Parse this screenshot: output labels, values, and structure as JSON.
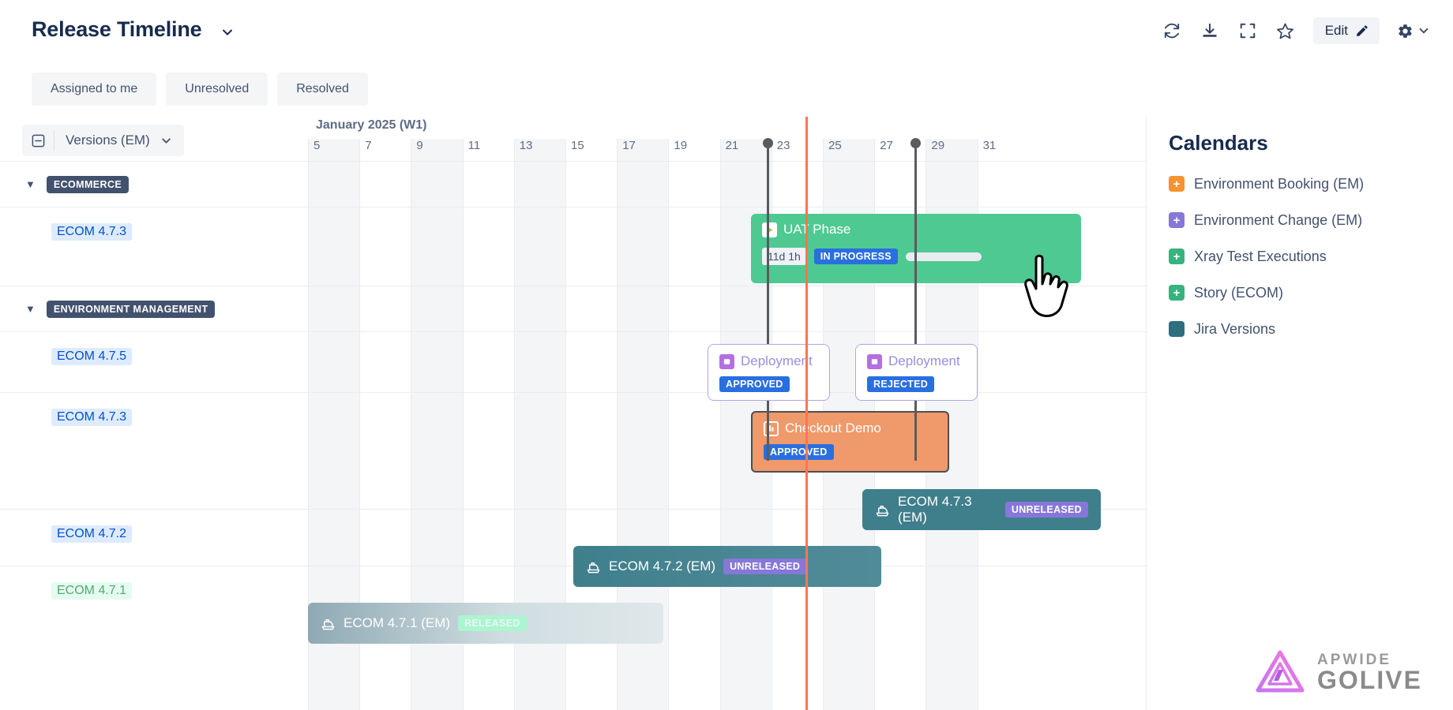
{
  "header": {
    "title": "Release Timeline",
    "title_chevron_icon": "chevron-down-icon",
    "toolbar": {
      "refresh_icon": "refresh-icon",
      "download_icon": "download-icon",
      "fullscreen_icon": "fullscreen-icon",
      "favorite_icon": "star-icon",
      "edit_label": "Edit",
      "edit_icon": "pencil-icon",
      "settings_icon": "gear-icon",
      "settings_chevron_icon": "chevron-down-icon"
    }
  },
  "filters": [
    {
      "label": "Assigned to me"
    },
    {
      "label": "Unresolved"
    },
    {
      "label": "Resolved"
    }
  ],
  "left_panel": {
    "collapse_icon": "collapse-minus-icon",
    "grouping_label": "Versions (EM)",
    "grouping_chevron_icon": "chevron-down-icon",
    "rows": [
      {
        "type": "group",
        "label": "ECOMMERCE",
        "caret_icon": "caret-down-icon"
      },
      {
        "type": "version",
        "label": "ECOM 4.7.3",
        "style": "blue"
      },
      {
        "type": "group",
        "label": "ENVIRONMENT MANAGEMENT",
        "caret_icon": "caret-down-icon"
      },
      {
        "type": "version",
        "label": "ECOM 4.7.5",
        "style": "blue"
      },
      {
        "type": "version",
        "label": "ECOM 4.7.3",
        "style": "blue"
      },
      {
        "type": "version",
        "label": "ECOM 4.7.2",
        "style": "blue"
      },
      {
        "type": "version",
        "label": "ECOM 4.7.1",
        "style": "green"
      }
    ]
  },
  "timeline": {
    "month_label": "January 2025 (W1)",
    "day_ticks": [
      "5",
      "7",
      "9",
      "11",
      "13",
      "15",
      "17",
      "19",
      "21",
      "23",
      "25",
      "27",
      "29",
      "31"
    ],
    "today_marker_color": "#ff7452",
    "events": [
      {
        "id": "uat-phase",
        "title": "UAT Phase",
        "icon": "play-square-icon",
        "duration": "11d 1h",
        "status": "IN PROGRESS",
        "status_color": "#2a6fe0",
        "bar_color": "#4ec992",
        "progress_percent": 0
      },
      {
        "id": "deployment-approved",
        "title": "Deployment",
        "icon": "document-icon",
        "status": "APPROVED",
        "status_color": "#2a6fe0",
        "border_color": "#b3a4e8"
      },
      {
        "id": "deployment-rejected",
        "title": "Deployment",
        "icon": "document-icon",
        "status": "REJECTED",
        "status_color": "#2a6fe0",
        "border_color": "#b3a4e8"
      },
      {
        "id": "checkout-demo",
        "title": "Checkout Demo",
        "icon": "environment-icon",
        "status": "APPROVED",
        "status_color": "#2a6fe0",
        "bar_color": "#f0996a"
      },
      {
        "id": "version-473",
        "title": "ECOM 4.7.3 (EM)",
        "icon": "ship-icon",
        "status": "UNRELEASED",
        "status_color": "#8777d9",
        "bar_color": "#3f7f8c"
      },
      {
        "id": "version-472",
        "title": "ECOM 4.7.2 (EM)",
        "icon": "ship-icon",
        "status": "UNRELEASED",
        "status_color": "#8777d9",
        "bar_color": "#3f7f8c"
      },
      {
        "id": "version-471",
        "title": "ECOM 4.7.1 (EM)",
        "icon": "ship-icon",
        "status": "RELEASED",
        "status_color": "#abf5d1",
        "bar_color": "#b7c9d0"
      }
    ]
  },
  "calendars": {
    "title": "Calendars",
    "items": [
      {
        "label": "Environment Booking (EM)",
        "color": "#f79232",
        "icon": "plus-square-icon"
      },
      {
        "label": "Environment Change (EM)",
        "color": "#8777d9",
        "icon": "plus-square-icon"
      },
      {
        "label": "Xray Test Executions",
        "color": "#36b37e",
        "icon": "plus-square-icon"
      },
      {
        "label": "Story (ECOM)",
        "color": "#36b37e",
        "icon": "plus-square-icon"
      },
      {
        "label": "Jira Versions",
        "color": "#2d6f7e",
        "icon": "square-icon"
      }
    ]
  },
  "branding": {
    "name_top": "APWIDE",
    "name_bottom": "GOLIVE",
    "logo_icon": "apwide-triangle-logo"
  }
}
